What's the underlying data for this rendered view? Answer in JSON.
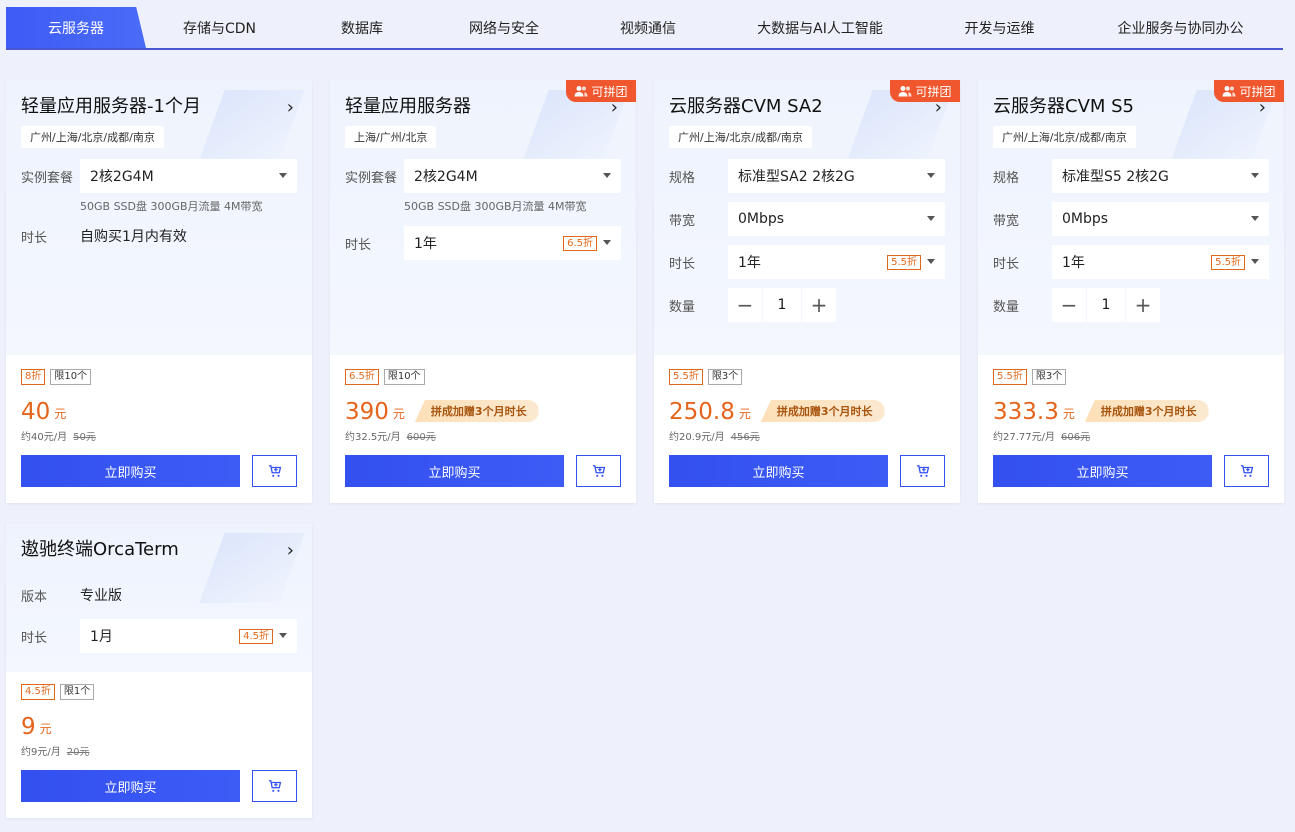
{
  "tabs": [
    {
      "label": "云服务器",
      "active": true
    },
    {
      "label": "存储与CDN"
    },
    {
      "label": "数据库"
    },
    {
      "label": "网络与安全"
    },
    {
      "label": "视频通信"
    },
    {
      "label": "大数据与AI人工智能"
    },
    {
      "label": "开发与运维"
    },
    {
      "label": "企业服务与协同办公"
    }
  ],
  "common": {
    "buy_label": "立即购买",
    "group_badge": "可拼团",
    "price_unit": "元",
    "promo": "拼成加赠3个月时长",
    "arrow": "›"
  },
  "colors": {
    "accent": "#3350f0",
    "price": "#e5641b",
    "badge": "#f0572e"
  },
  "cards": [
    {
      "title": "轻量应用服务器-1个月",
      "region": "广州/上海/北京/成都/南京",
      "spec_label": "实例套餐",
      "spec_value": "2核2G4M",
      "spec_note": "50GB SSD盘 300GB月流量 4M带宽",
      "duration_label": "时长",
      "duration_value": "自购买1月内有效",
      "tag_discount": "8折",
      "tag_limit": "限10个",
      "price": "40",
      "per_month": "约40元/月",
      "original": "50元"
    },
    {
      "title": "轻量应用服务器",
      "region": "上海/广州/北京",
      "spec_label": "实例套餐",
      "spec_value": "2核2G4M",
      "spec_note": "50GB SSD盘 300GB月流量 4M带宽",
      "duration_label": "时长",
      "duration_value": "1年",
      "duration_discount": "6.5折",
      "tag_discount": "6.5折",
      "tag_limit": "限10个",
      "price": "390",
      "per_month": "约32.5元/月",
      "original": "600元"
    },
    {
      "title": "云服务器CVM SA2",
      "region": "广州/上海/北京/成都/南京",
      "spec_label": "规格",
      "spec_value": "标准型SA2 2核2G",
      "bw_label": "带宽",
      "bw_value": "0Mbps",
      "duration_label": "时长",
      "duration_value": "1年",
      "duration_discount": "5.5折",
      "qty_label": "数量",
      "qty_value": "1",
      "tag_discount": "5.5折",
      "tag_limit": "限3个",
      "price": "250.8",
      "per_month": "约20.9元/月",
      "original": "456元"
    },
    {
      "title": "云服务器CVM S5",
      "region": "广州/上海/北京/成都/南京",
      "spec_label": "规格",
      "spec_value": "标准型S5 2核2G",
      "bw_label": "带宽",
      "bw_value": "0Mbps",
      "duration_label": "时长",
      "duration_value": "1年",
      "duration_discount": "5.5折",
      "qty_label": "数量",
      "qty_value": "1",
      "tag_discount": "5.5折",
      "tag_limit": "限3个",
      "price": "333.3",
      "per_month": "约27.77元/月",
      "original": "606元"
    },
    {
      "title": "遨驰终端OrcaTerm",
      "version_label": "版本",
      "version_value": "专业版",
      "duration_label": "时长",
      "duration_value": "1月",
      "duration_discount": "4.5折",
      "tag_discount": "4.5折",
      "tag_limit": "限1个",
      "price": "9",
      "per_month": "约9元/月",
      "original": "20元"
    }
  ]
}
